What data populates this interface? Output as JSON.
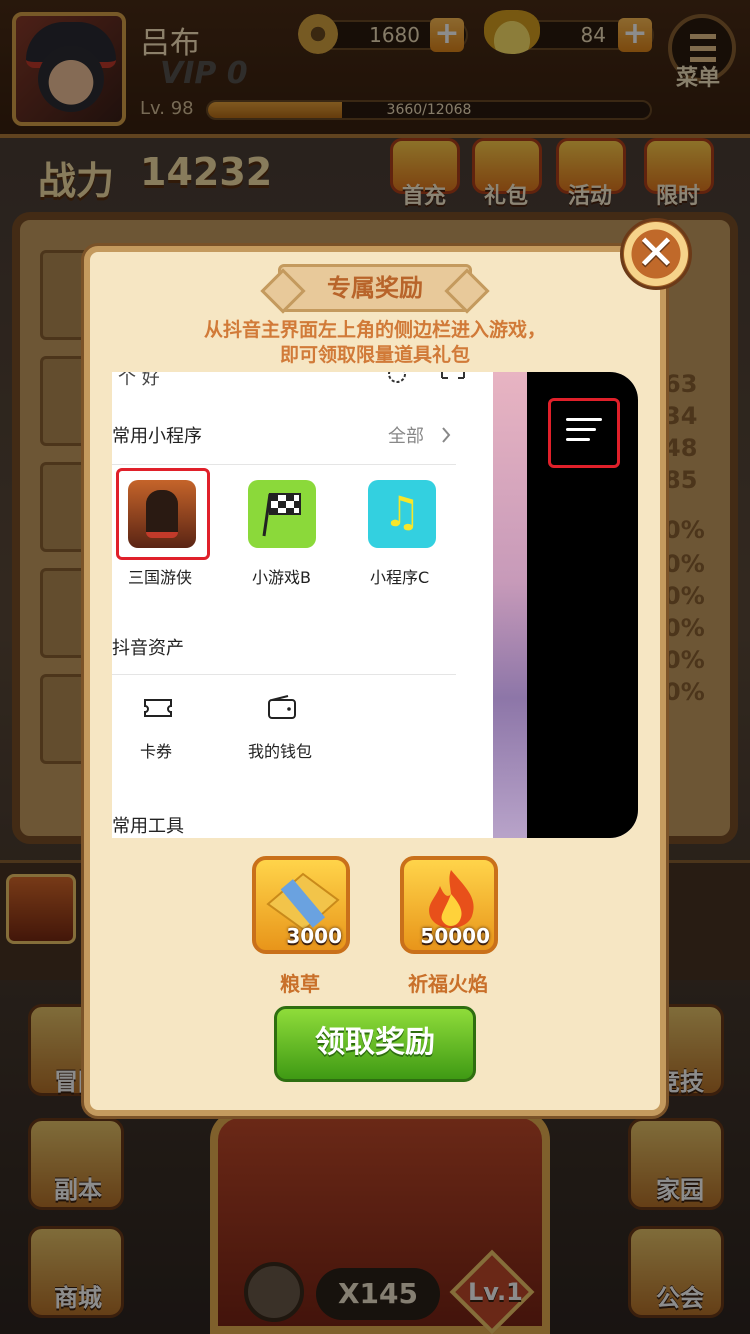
{
  "player": {
    "name": "吕布",
    "vip": "VIP 0",
    "level": "Lv. 98",
    "exp": "3660/12068",
    "exp_fraction": 0.303
  },
  "currency": {
    "coins": "1680",
    "ingots": "84"
  },
  "menu_label": "菜单",
  "power": {
    "label": "战力",
    "value": "14232"
  },
  "top_icons": [
    "首充",
    "礼包",
    "活动",
    "限时"
  ],
  "side_right_stats": [
    "63",
    "34",
    "48",
    "85",
    "0%",
    "0%",
    "0%",
    "0%",
    "0%",
    "0%"
  ],
  "left_buttons": [
    "冒险",
    "副本",
    "商城"
  ],
  "right_buttons": [
    "竞技",
    "家园",
    "公会"
  ],
  "bottom": {
    "count": "X145",
    "chest_level": "Lv.1"
  },
  "modal": {
    "close_symbol": "✕",
    "title": "专属奖励",
    "subtitle": "从抖音主界面左上角的侧边栏进入游戏，即可领取限量道具礼包",
    "claim_button": "领取奖励",
    "rewards": [
      {
        "name": "粮草",
        "count": "3000"
      },
      {
        "name": "祈福火焰",
        "count": "50000"
      }
    ]
  },
  "screenshot": {
    "top_partial": "个 好",
    "section_mini_programs": "常用小程序",
    "see_all": "全部",
    "apps": [
      "三国游侠",
      "小游戏B",
      "小程序C"
    ],
    "section_assets": "抖音资产",
    "assets": [
      "卡券",
      "我的钱包"
    ],
    "section_tools": "常用工具"
  },
  "colors": {
    "highlight_red": "#e0202a",
    "accent_orange": "#d17a38",
    "button_green": "#3f9a14"
  }
}
